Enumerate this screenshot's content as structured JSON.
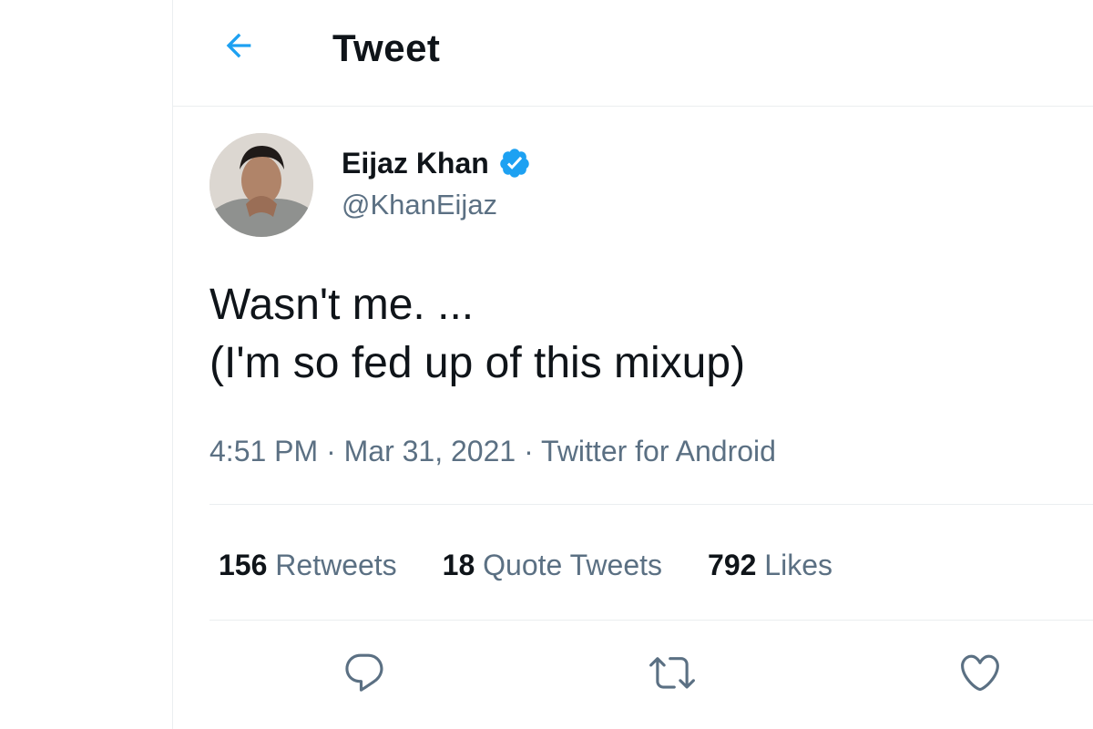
{
  "header": {
    "back_icon": "arrow-left-icon",
    "title": "Tweet"
  },
  "author": {
    "name": "Eijaz Khan",
    "handle": "@KhanEijaz",
    "verified_icon": "verified-badge-icon",
    "verified_color": "#1da1f2"
  },
  "tweet": {
    "lines": [
      "Wasn't me. ...",
      "(I'm so fed up of this mixup)"
    ],
    "time": "4:51 PM",
    "separator": "·",
    "date": "Mar 31, 2021",
    "source": "Twitter for Android"
  },
  "stats": {
    "retweets": {
      "count": "156",
      "label": "Retweets"
    },
    "quotes": {
      "count": "18",
      "label": "Quote Tweets"
    },
    "likes": {
      "count": "792",
      "label": "Likes"
    }
  },
  "actions": {
    "reply_icon": "reply-icon",
    "retweet_icon": "retweet-icon",
    "like_icon": "heart-icon"
  },
  "colors": {
    "accent": "#1da1f2",
    "text": "#0f1419",
    "secondary": "#5b7083",
    "border": "#ebeef0"
  }
}
